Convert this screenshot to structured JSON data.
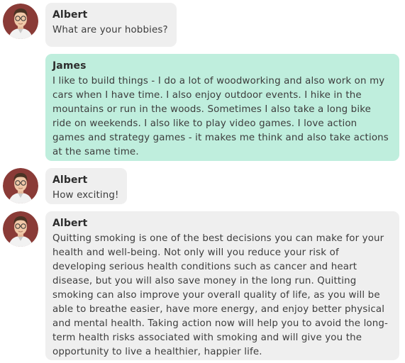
{
  "messages": [
    {
      "sender": "Albert",
      "role": "bot",
      "avatar": "male-avatar-glasses",
      "text": "What are your hobbies?"
    },
    {
      "sender": "James",
      "role": "user",
      "text": "I like to build things - I do a lot of woodworking and also work on my cars when I have time. I also enjoy outdoor events. I hike in the mountains or run in the woods. Sometimes I also take a long bike ride on weekends. I also like to play video games. I love action games and strategy games - it makes me think and also take actions at the same time."
    },
    {
      "sender": "Albert",
      "role": "bot",
      "avatar": "male-avatar-glasses",
      "text": "How exciting!"
    },
    {
      "sender": "Albert",
      "role": "bot",
      "avatar": "male-avatar-glasses",
      "text": "Quitting smoking is one of the best decisions you can make for your health and well-being. Not only will you reduce your risk of developing serious health conditions such as cancer and heart disease, but you will also save money in the long run. Quitting smoking can also improve your overall quality of life, as you will be able to breathe easier, have more energy, and enjoy better physical and mental health. Taking action now will help you to avoid the long-term health risks associated with smoking and will give you the opportunity to live a healthier, happier life."
    }
  ],
  "colors": {
    "bot_bubble": "#efefef",
    "user_bubble": "#bfeedd",
    "avatar_bg": "#8a3b37"
  }
}
